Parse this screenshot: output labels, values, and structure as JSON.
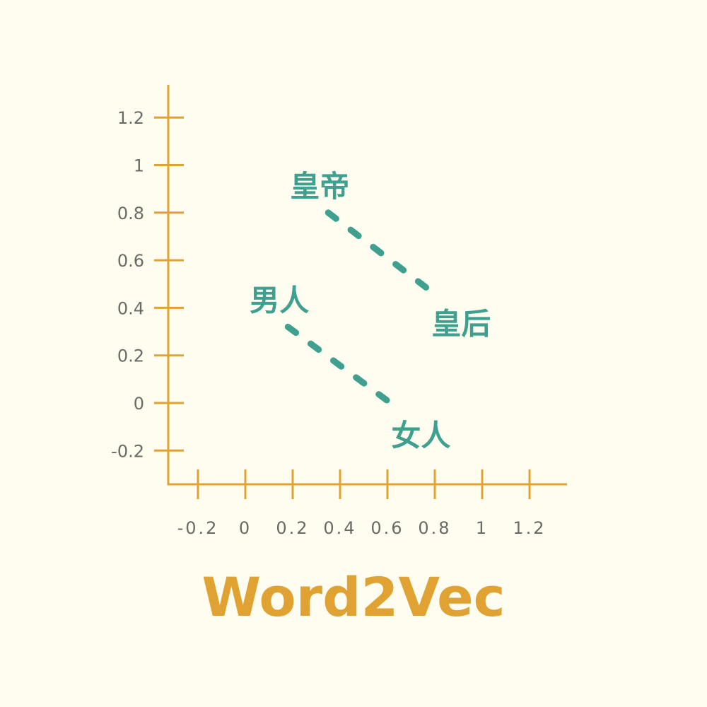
{
  "colors": {
    "axis": "#e0a333",
    "accent": "#3fa090",
    "text": "#6a6a66",
    "background": "#fffdef"
  },
  "chart_data": {
    "type": "scatter",
    "title": "Word2Vec",
    "xlabel": "",
    "ylabel": "",
    "xticks": [
      -0.2,
      0,
      0.2,
      0.4,
      0.6,
      0.8,
      1,
      1.2
    ],
    "xtick_labels": [
      "-0.2",
      "0",
      "0.2",
      "0.4",
      "0.6",
      "0.8",
      "1",
      "1.2"
    ],
    "yticks": [
      1.2,
      1,
      0.8,
      0.6,
      0.4,
      0.2,
      0,
      -0.2
    ],
    "ytick_labels": [
      "1.2",
      "1",
      "0.8",
      "0.6",
      "0.4",
      "0.2",
      "0",
      "-0.2"
    ],
    "xlim": [
      -0.33,
      1.36
    ],
    "ylim": [
      -0.34,
      1.34
    ],
    "grid": false,
    "pairs": [
      {
        "from": {
          "word": "皇帝",
          "x": 0.35,
          "y": 0.8
        },
        "to": {
          "word": "皇后",
          "x": 0.81,
          "y": 0.45
        }
      },
      {
        "from": {
          "word": "男人",
          "x": 0.18,
          "y": 0.32
        },
        "to": {
          "word": "女人",
          "x": 0.64,
          "y": -0.02
        }
      }
    ]
  }
}
